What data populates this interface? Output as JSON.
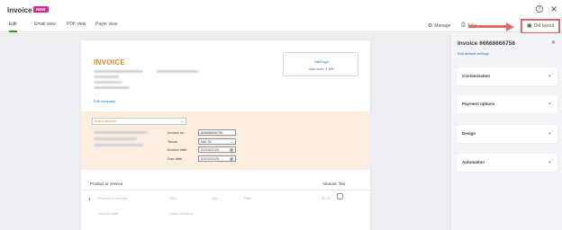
{
  "app": {
    "title": "Invoice",
    "badge": "NEW",
    "help_icon": "help-circle-icon",
    "close_icon": "close-icon"
  },
  "tabs": [
    {
      "label": "Edit",
      "active": true
    },
    {
      "label": "Email view",
      "active": false
    },
    {
      "label": "PDF view",
      "active": false
    },
    {
      "label": "Payer view",
      "active": false
    }
  ],
  "toolbar": {
    "manage_label": "Manage",
    "take_label": "Take",
    "old_layout_label": "Old layout"
  },
  "invoice": {
    "heading": "INVOICE",
    "edit_company": "Edit company",
    "logo_add": "Add logo",
    "logo_size": "Max size: 1 MB",
    "customer_placeholder": "Add customer",
    "fields": [
      {
        "label": "Invoice no.",
        "value": "66666666756",
        "suffix": ""
      },
      {
        "label": "Terms",
        "value": "Net 30",
        "suffix": "⌄"
      },
      {
        "label": "Invoice date",
        "value": "01/03/2023",
        "suffix": "▦"
      },
      {
        "label": "Due date",
        "value": "02/02/2023",
        "suffix": "▦"
      }
    ],
    "line_header": {
      "product": "Product or service",
      "amount": "Amount",
      "tax": "Tax"
    },
    "line": {
      "num": "1",
      "product_ph": "Product or service",
      "sku_ph": "SKU",
      "qty_ph": "Qty",
      "rate_ph": "Rate",
      "amount_ph": "$0.00",
      "service_date_ph": "Service date",
      "class_ph": "Class (hidden)"
    }
  },
  "panel": {
    "title": "Invoice 66666666756",
    "link": "Edit default settings",
    "sections": [
      "Customization",
      "Payment options",
      "Design",
      "Automation"
    ]
  },
  "colors": {
    "accent_green": "#2ca01c",
    "badge_pink": "#d52b8f",
    "invoice_orange": "#e28c2a",
    "link_blue": "#0077c5",
    "highlight_red": "#e06a66",
    "peach_bg": "#fbeee1"
  }
}
